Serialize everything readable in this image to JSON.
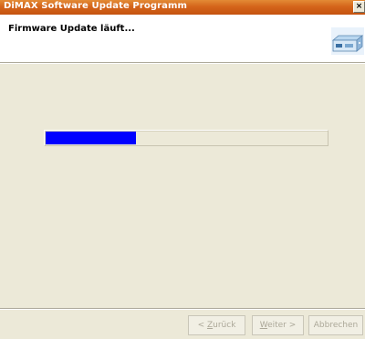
{
  "window": {
    "title": "DiMAX Software Update Programm",
    "close_label": "×"
  },
  "header": {
    "heading": "Firmware Update läuft...",
    "icon": "device-icon"
  },
  "progress": {
    "value_fraction": 0.32,
    "fill_color": "#0000ff"
  },
  "buttons": {
    "back_mnemonic": "Z",
    "back_prefix": "< ",
    "back_rest": "urück",
    "next_mnemonic": "W",
    "next_rest": "eiter >",
    "cancel_label": "Abbrechen",
    "enabled": false
  },
  "colors": {
    "title_bar": "#d5651b",
    "dialog_bg": "#ece9d8",
    "disabled_text": "#aca899"
  }
}
